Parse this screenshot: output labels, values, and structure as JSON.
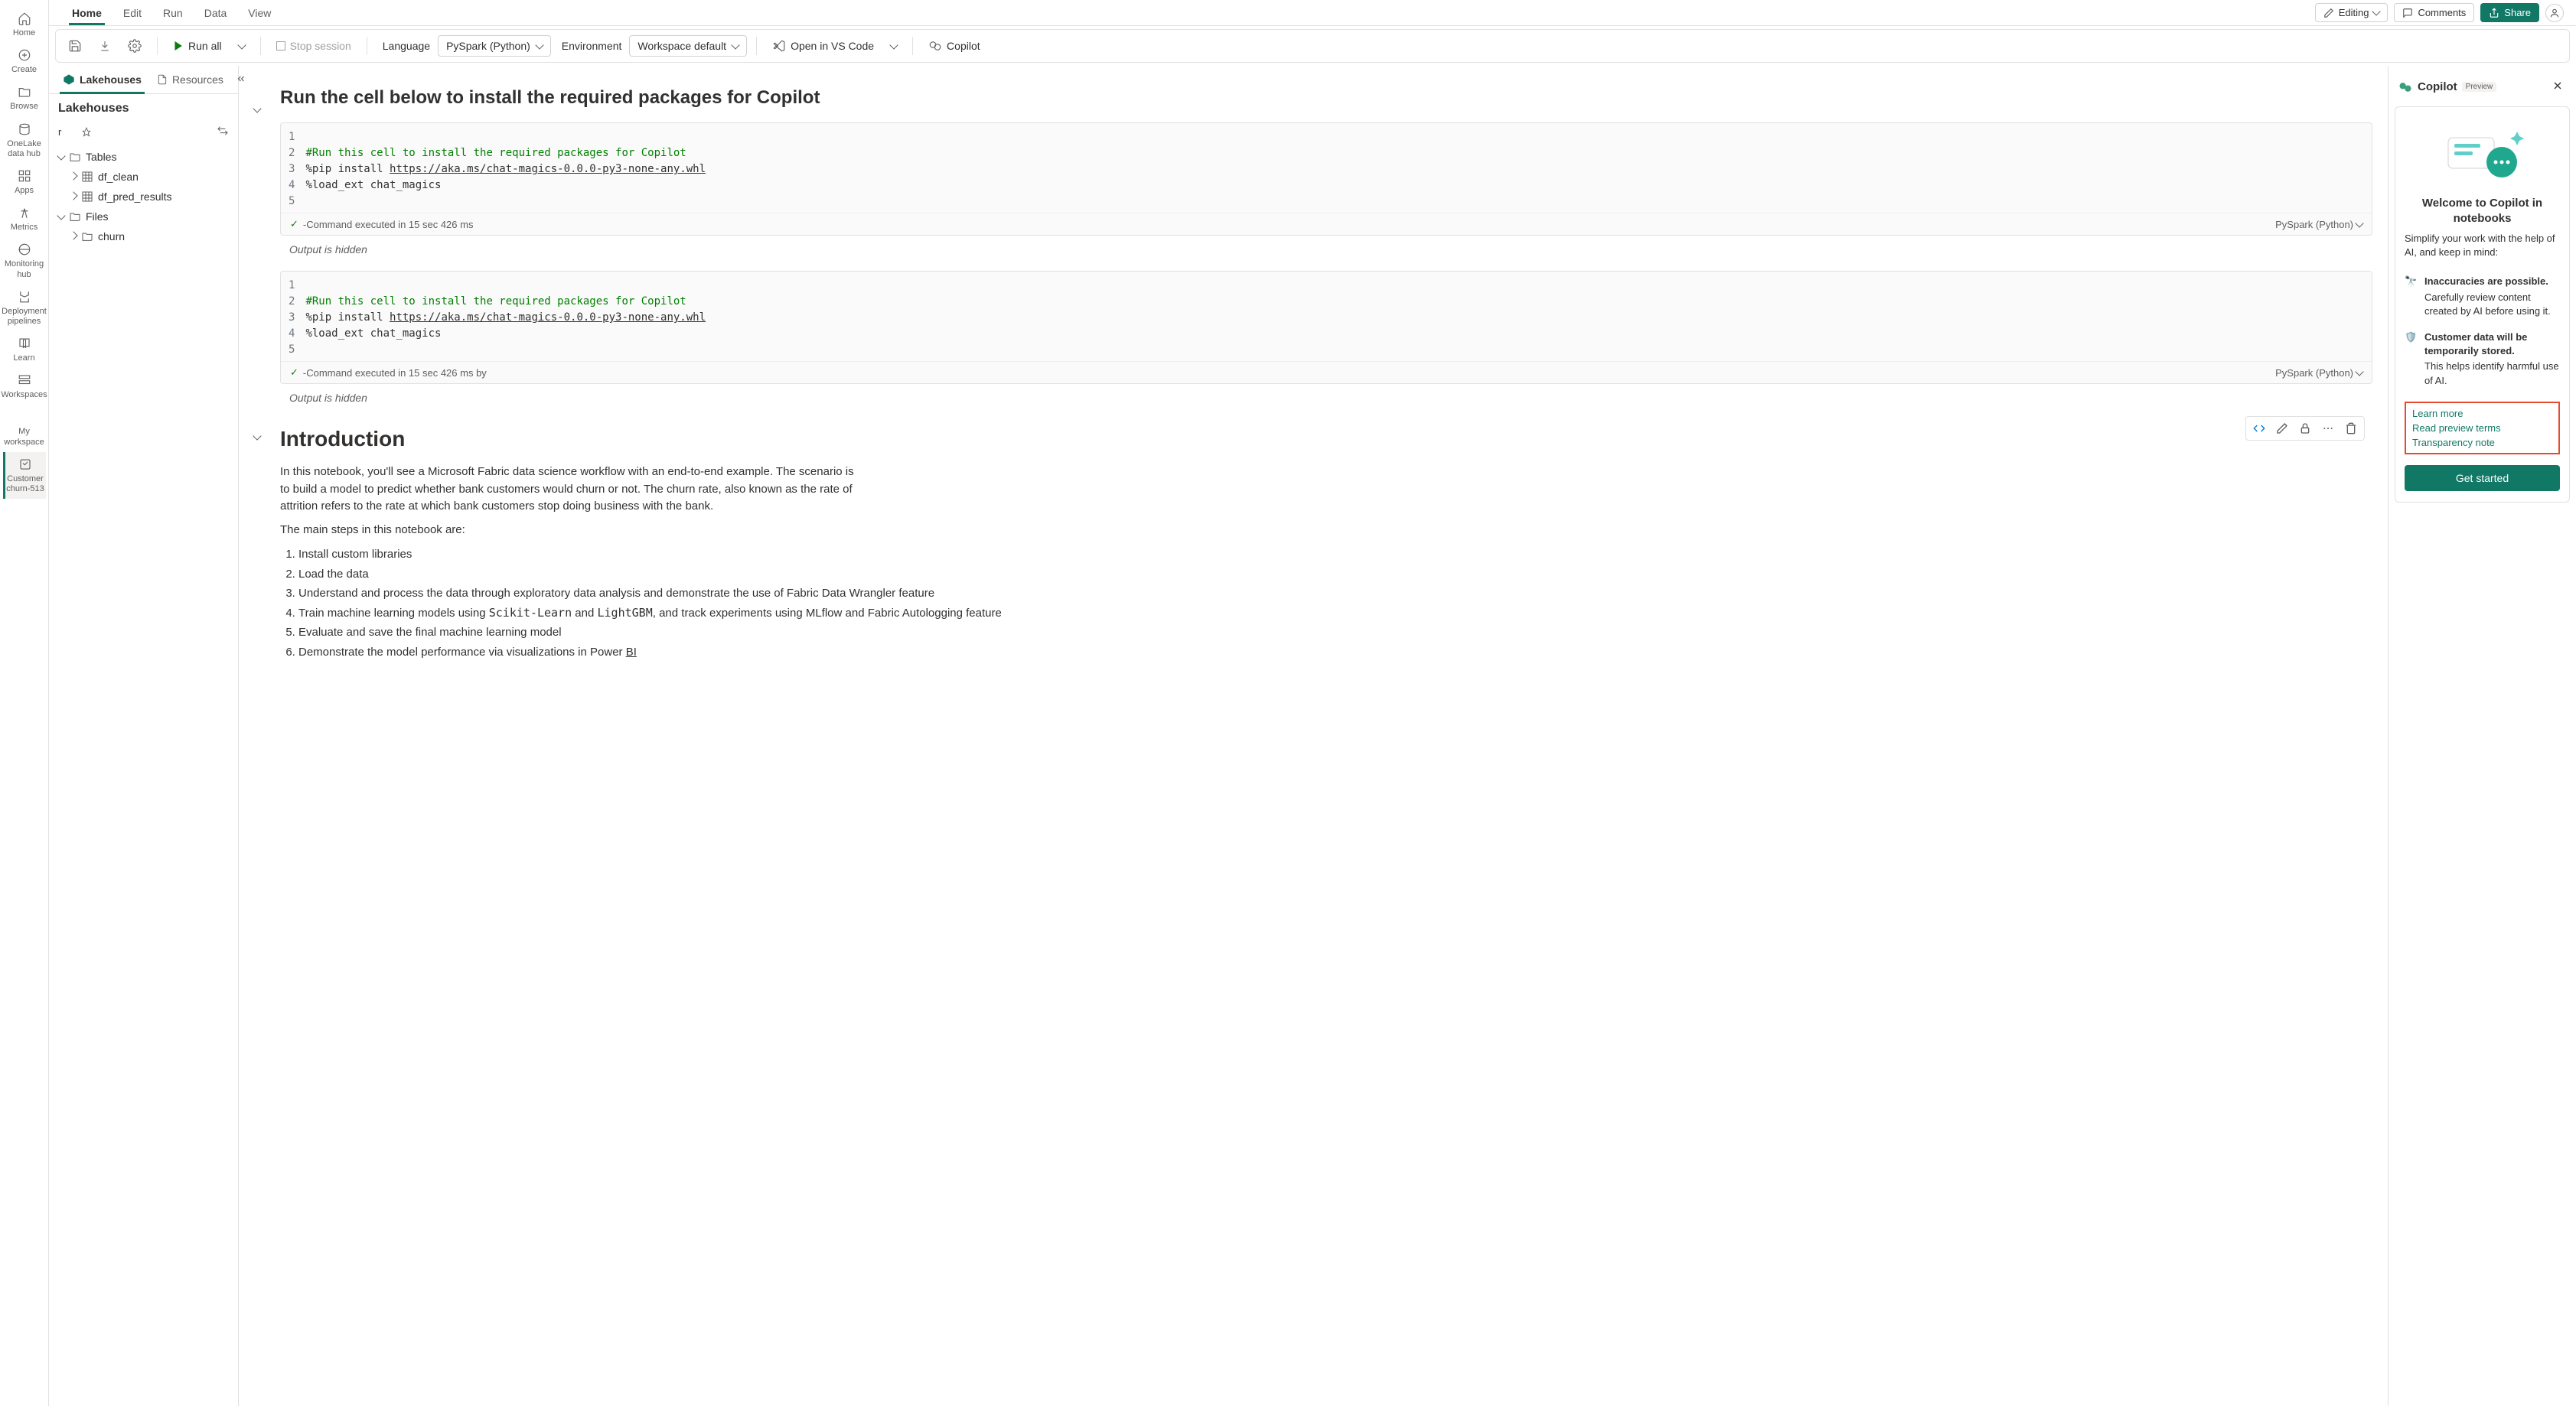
{
  "nav_rail": [
    {
      "id": "home",
      "label": "Home"
    },
    {
      "id": "create",
      "label": "Create"
    },
    {
      "id": "browse",
      "label": "Browse"
    },
    {
      "id": "onelake",
      "label": "OneLake data hub"
    },
    {
      "id": "apps",
      "label": "Apps"
    },
    {
      "id": "metrics",
      "label": "Metrics"
    },
    {
      "id": "monitoring",
      "label": "Monitoring hub"
    },
    {
      "id": "pipelines",
      "label": "Deployment pipelines"
    },
    {
      "id": "learn",
      "label": "Learn"
    },
    {
      "id": "workspaces",
      "label": "Workspaces"
    },
    {
      "id": "myworkspace",
      "label": "My workspace"
    },
    {
      "id": "customer",
      "label": "Customer churn-513"
    }
  ],
  "ribbon_tabs": [
    "Home",
    "Edit",
    "Run",
    "Data",
    "View"
  ],
  "top_right": {
    "editing": "Editing",
    "comments": "Comments",
    "share": "Share"
  },
  "toolbar": {
    "run_all": "Run all",
    "stop": "Stop session",
    "lang_label": "Language",
    "lang_value": "PySpark (Python)",
    "env_label": "Environment",
    "env_value": "Workspace default",
    "vscode": "Open in VS Code",
    "copilot": "Copilot"
  },
  "explorer": {
    "tabs": [
      "Lakehouses",
      "Resources"
    ],
    "header": "Lakehouses",
    "r": "r",
    "tree": {
      "tables": "Tables",
      "df_clean": "df_clean",
      "df_pred": "df_pred_results",
      "files": "Files",
      "churn": "churn"
    }
  },
  "notebook": {
    "h1": "Run the cell below to install the required packages for Copilot",
    "code_lines": [
      "",
      "#Run this cell to install the required packages for Copilot",
      "%pip install https://aka.ms/chat-magics-0.0.0-py3-none-any.whl",
      "%load_ext chat_magics",
      ""
    ],
    "status1": "-Command executed in 15 sec 426 ms",
    "status2": "-Command executed in 15 sec 426 ms by",
    "cell_lang": "PySpark (Python)",
    "output_hidden": "Output is hidden",
    "intro_title": "Introduction",
    "intro_p1": "In this notebook, you'll see a Microsoft Fabric data science workflow with an end-to-end example. The scenario is to build a model to predict whether bank customers would churn or not. The churn rate, also known as the rate of attrition refers to the rate at which bank customers stop doing business with the bank.",
    "intro_p2": "The main steps in this notebook are:",
    "intro_steps": [
      "Install custom libraries",
      "Load the data",
      "Understand and process the data through exploratory data analysis and demonstrate the use of Fabric Data Wrangler feature",
      "Train machine learning models using Scikit-Learn and LightGBM, and track experiments using MLflow and Fabric Autologging feature",
      "Evaluate and save the final machine learning model",
      "Demonstrate the model performance via visualizations in Power BI"
    ]
  },
  "copilot": {
    "title": "Copilot",
    "preview": "Preview",
    "welcome": "Welcome to Copilot in notebooks",
    "sub": "Simplify your work with the help of AI, and keep in mind:",
    "b1_title": "Inaccuracies are possible.",
    "b1_body": "Carefully review content created by AI before using it.",
    "b2_title": "Customer data will be temporarily stored.",
    "b2_body": "This helps identify harmful use of AI.",
    "links": [
      "Learn more",
      "Read preview terms",
      "Transparency note"
    ],
    "get_started": "Get started"
  }
}
